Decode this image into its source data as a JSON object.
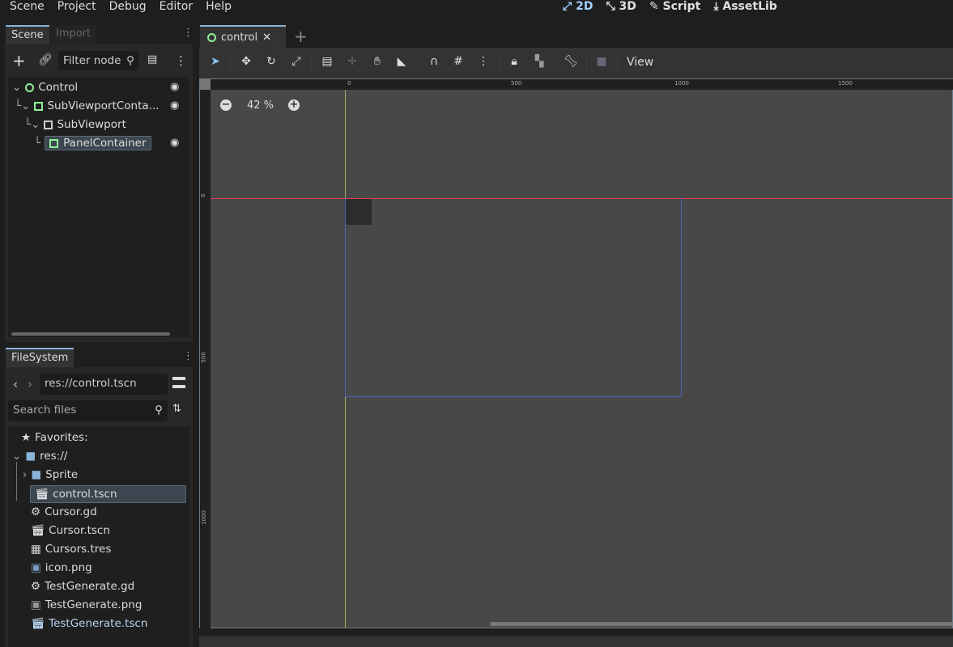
{
  "menu": [
    "Scene",
    "Project",
    "Debug",
    "Editor",
    "Help"
  ],
  "workspaces": {
    "w2d": "2D",
    "w3d": "3D",
    "script": "Script",
    "assetlib": "AssetLib"
  },
  "scene_dock": {
    "tab_scene": "Scene",
    "tab_import": "Import",
    "filter_placeholder": "Filter node",
    "nodes": [
      {
        "label": "Control"
      },
      {
        "label": "SubViewportConta..."
      },
      {
        "label": "SubViewport"
      },
      {
        "label": "PanelContainer"
      }
    ]
  },
  "filesystem": {
    "tab": "FileSystem",
    "path": "res://control.tscn",
    "search_placeholder": "Search files",
    "items": [
      "Favorites:",
      "res://",
      "Sprite",
      "control.tscn",
      "Cursor.gd",
      "Cursor.tscn",
      "Cursors.tres",
      "icon.png",
      "TestGenerate.gd",
      "TestGenerate.png",
      "TestGenerate.tscn"
    ]
  },
  "editor": {
    "scene_tab": "control",
    "view_menu": "View",
    "zoom": "42 %",
    "ruler_top": [
      "0",
      "500",
      "1000",
      "1500"
    ],
    "ruler_left": [
      "0",
      "500",
      "1000"
    ]
  },
  "colors": {
    "accent": "#8bb4d9",
    "node_green": "#8eef97",
    "x_axis": "#e0405a",
    "viewport_rect": "#5060b0"
  }
}
